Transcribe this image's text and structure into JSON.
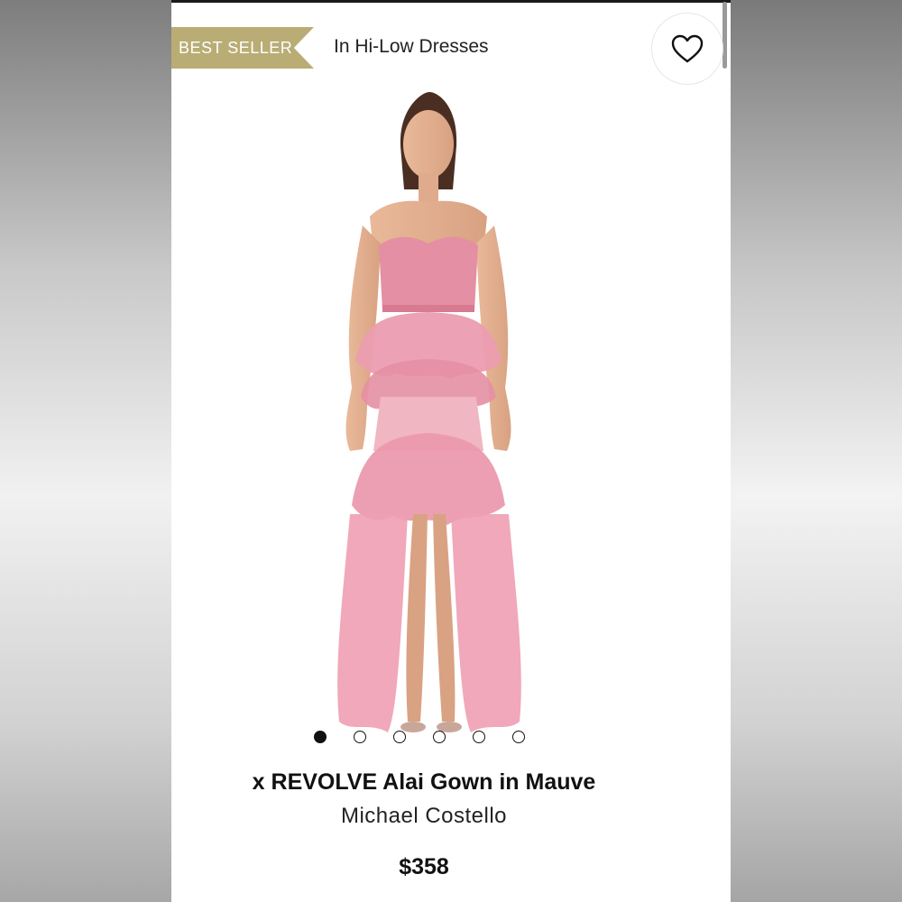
{
  "header": {
    "badge_label": "BEST SELLER",
    "category_label": "In Hi-Low Dresses",
    "wishlist_icon": "heart-outline-icon"
  },
  "gallery": {
    "image_count": 6,
    "active_index": 0
  },
  "product": {
    "title": "x REVOLVE Alai Gown in Mauve",
    "brand": "Michael Costello",
    "price": "$358"
  },
  "colors": {
    "badge": "#b9ad75",
    "gown": "#e79aab"
  }
}
